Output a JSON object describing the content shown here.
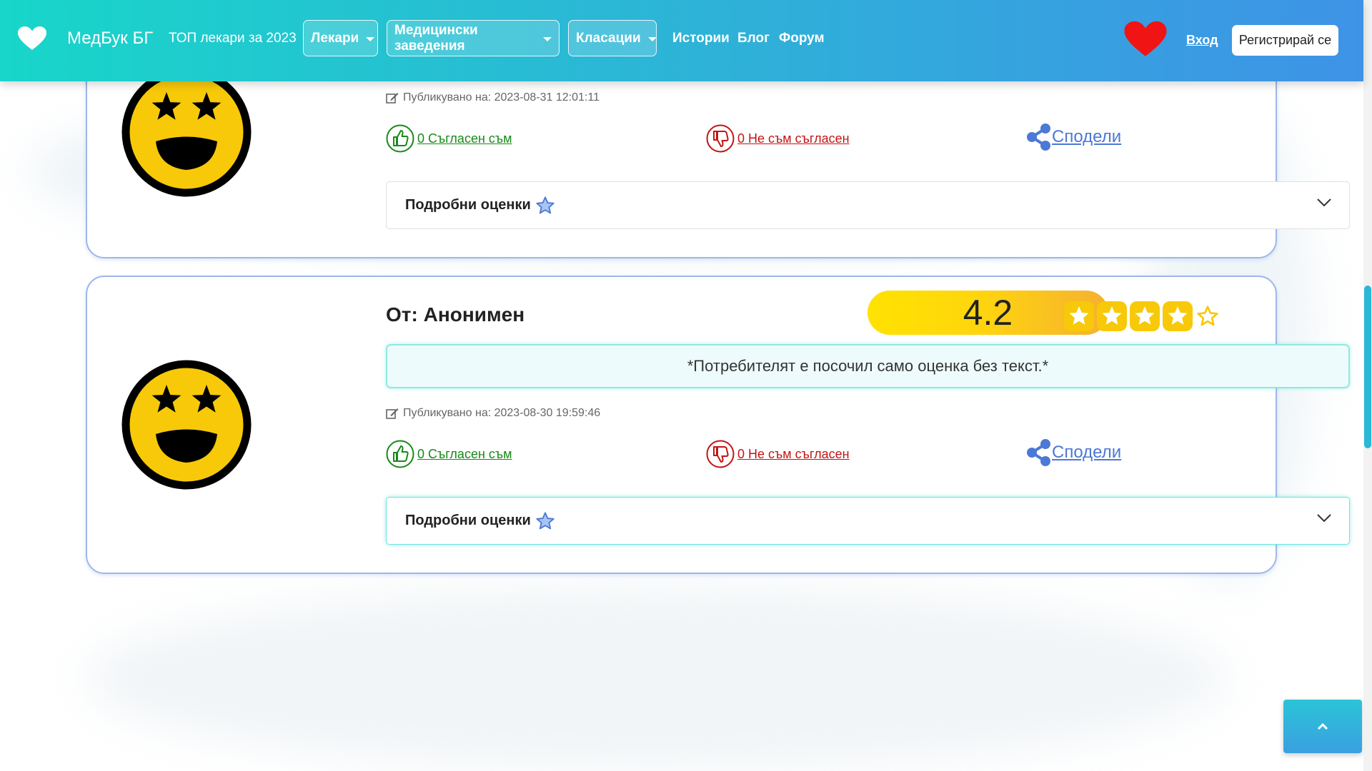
{
  "navbar": {
    "brand_icon": "heart-icon",
    "brand_text": "МедБук БГ",
    "top_doctors": "ТОП лекари за 2023",
    "dropdowns": [
      "Лекари",
      "Медицински заведения",
      "Класации"
    ],
    "links": [
      "Истории",
      "Блог",
      "Форум"
    ],
    "favorites_icon": "heart-icon",
    "login": "Вход",
    "register": "Регистрирай се"
  },
  "reviews": [
    {
      "published_label": "Публикувано на: 2023-08-31 12:01:11",
      "agree": "0 Съгласен съм",
      "disagree": "0 Не съм съгласен",
      "share": "Сподели",
      "details": "Подробни оценки"
    },
    {
      "author": "От: Анонимен",
      "score": "4.2",
      "stars_filled": 4,
      "stars_total": 5,
      "notice": "*Потребителят е посочил само оценка без текст.*",
      "published_label": "Публикувано на: 2023-08-30 19:59:46",
      "agree": "0 Съгласен съм",
      "disagree": "0 Не съм съгласен",
      "share": "Сподели",
      "details": "Подробни оценки"
    }
  ],
  "colors": {
    "nav_start": "#18d6c9",
    "nav_end": "#3e93e6",
    "agree": "#178a17",
    "disagree": "#c41414",
    "share": "#4c78d6",
    "score_gold": "#ffd60d"
  }
}
